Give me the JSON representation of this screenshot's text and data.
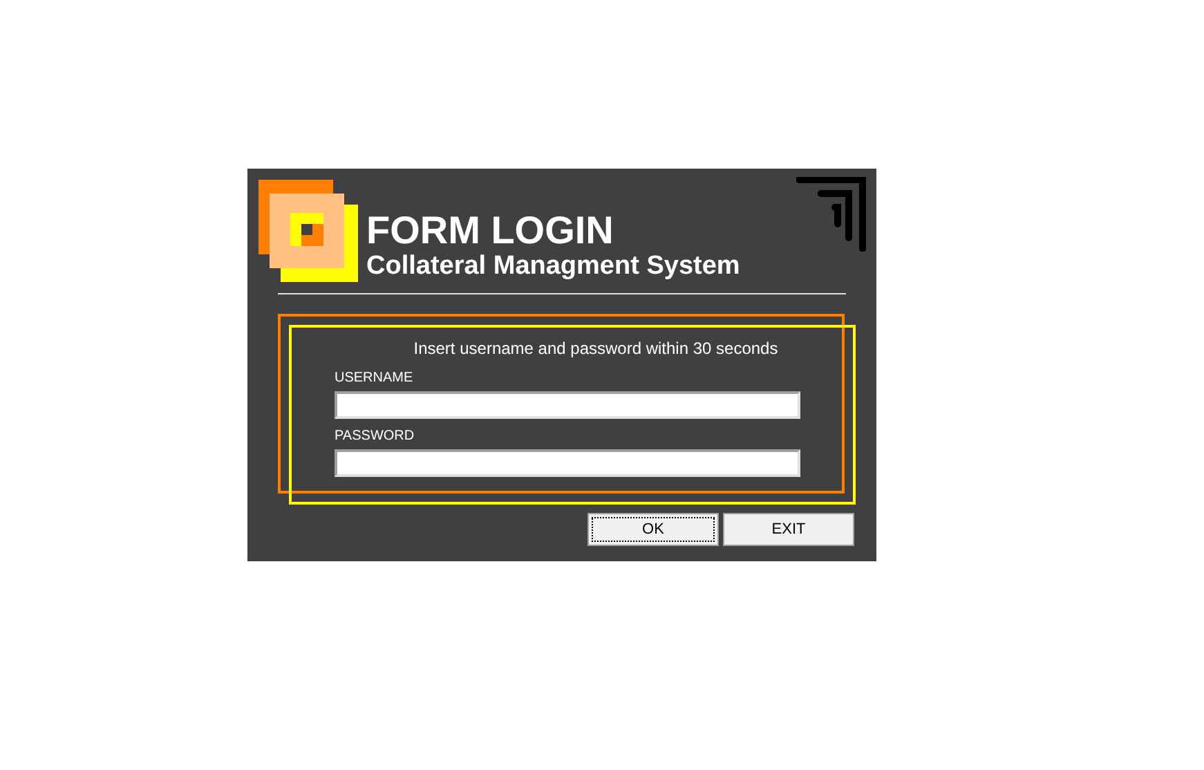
{
  "header": {
    "title": "FORM LOGIN",
    "subtitle": "Collateral Managment System"
  },
  "form": {
    "instruction": "Insert username and password within 30 seconds",
    "fields": [
      {
        "label": "USERNAME"
      },
      {
        "label": "PASSWORD"
      }
    ]
  },
  "buttons": [
    {
      "label": "OK",
      "focused": true
    },
    {
      "label": "EXIT",
      "focused": false
    }
  ]
}
